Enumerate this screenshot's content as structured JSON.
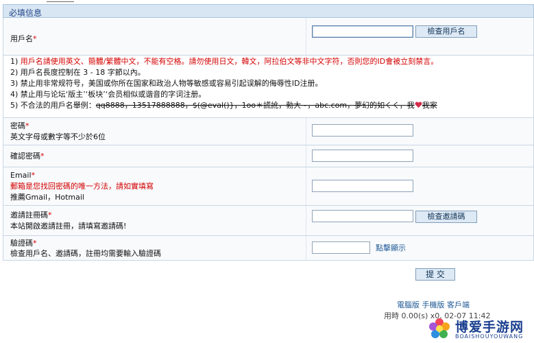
{
  "section_title": "必填信息",
  "username": {
    "label": "用戶名",
    "required_mark": "*",
    "check_button": "檢查用戶名"
  },
  "rules": [
    {
      "num": "1)",
      "text": "用戶名請使用英文、簡體/繁體中文，不能有空格。請勿使用日文，韓文，阿拉伯文等非中文字符，否則您的ID會被立刻禁言。"
    },
    {
      "num": "2)",
      "text": "用戶名長度控制在 3 - 18 字節以內。"
    },
    {
      "num": "3)",
      "text": "禁止用非常规符号，美国或你所在国家和政治人物等敏感或容易引起误解的侮辱性ID注册。"
    },
    {
      "num": "4)",
      "text": "禁止用与论坛‘版主’‘板块’‘会员相似或谐音的字词注册。"
    },
    {
      "num": "5)",
      "text_plain": "不合法的用戶名舉例：",
      "text_struck": "qq8888，13517888888，$(@eval()}，1oo＊謊訛，勃大~，abc.com，夢幻的如くく，我",
      "text_after": "我家"
    }
  ],
  "password": {
    "label": "密碼",
    "required_mark": "*",
    "hint": "英文字母或數字等不少於6位"
  },
  "confirm_password": {
    "label": "確認密碼",
    "required_mark": "*"
  },
  "email": {
    "label": "Email",
    "required_mark": "*",
    "hint_red": "郵箱是您找回密碼的唯一方法，請如實填寫",
    "hint": "推薦Gmail，Hotmail"
  },
  "invite": {
    "label": "邀請註冊碼",
    "required_mark": "*",
    "hint": "本站開啟邀請註冊，請填寫邀請碼!",
    "check_button": "檢查邀請碼"
  },
  "captcha": {
    "label": "驗證碼",
    "required_mark": "*",
    "hint": "檢查用戶名、邀請碼，註冊均需要輸入驗證碼",
    "show_link": "點擊顯示"
  },
  "submit_label": "提 交",
  "footer": {
    "links": "電腦版 手機版 客戶端",
    "stats": "用時 0.00(s) x0, 02-07 11:42"
  },
  "watermark": {
    "title": "博爱手游网",
    "subtitle": "BOAISHOUYOUWANG"
  },
  "colors": {
    "header_bg": "#d8e6f3",
    "required": "#d40000",
    "link": "#1f5a96",
    "button_bg": "#dde9f5"
  }
}
